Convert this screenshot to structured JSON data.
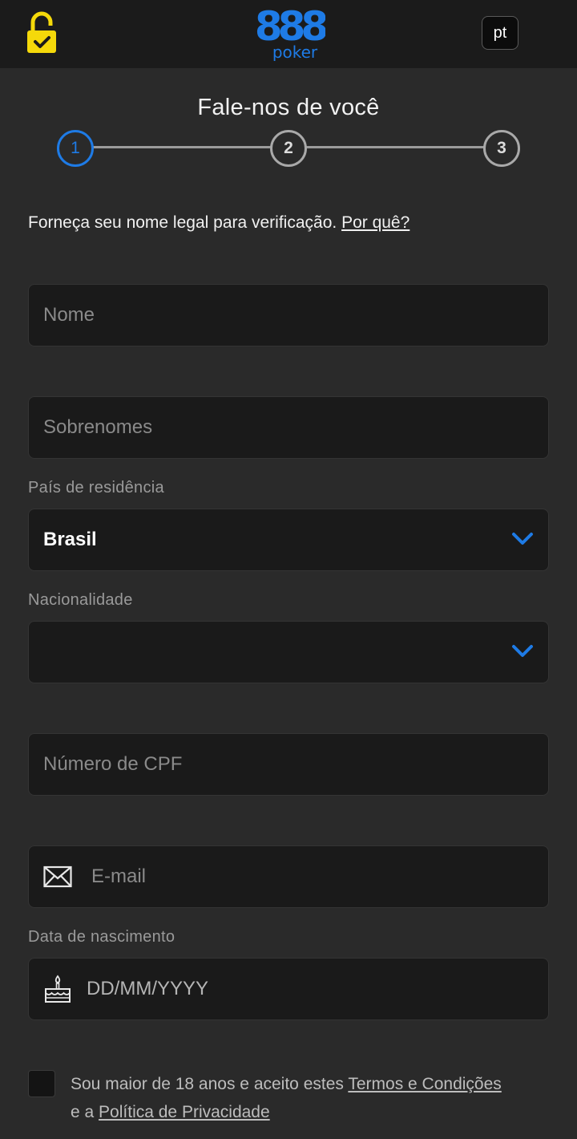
{
  "header": {
    "logo_number": "888",
    "logo_word": "poker",
    "language": "pt"
  },
  "title": "Fale-nos de você",
  "steps": [
    "1",
    "2",
    "3"
  ],
  "intro": {
    "text": "Forneça seu nome legal para verificação.",
    "link": "Por quê?"
  },
  "form": {
    "first_name_placeholder": "Nome",
    "last_name_placeholder": "Sobrenomes",
    "country_label": "País de residência",
    "country_value": "Brasil",
    "nationality_label": "Nacionalidade",
    "nationality_value": "",
    "cpf_placeholder": "Número de CPF",
    "email_placeholder": "E-mail",
    "dob_label": "Data de nascimento",
    "dob_placeholder": "DD/MM/YYYY"
  },
  "terms": {
    "text_before": "Sou maior de 18 anos e aceito estes",
    "terms_link": "Termos e Condições",
    "text_middle": "e a",
    "privacy_link": "Política de Privacidade"
  },
  "colors": {
    "accent": "#1e7be6",
    "lock": "#f5d90a",
    "background": "#2a2a2a"
  }
}
